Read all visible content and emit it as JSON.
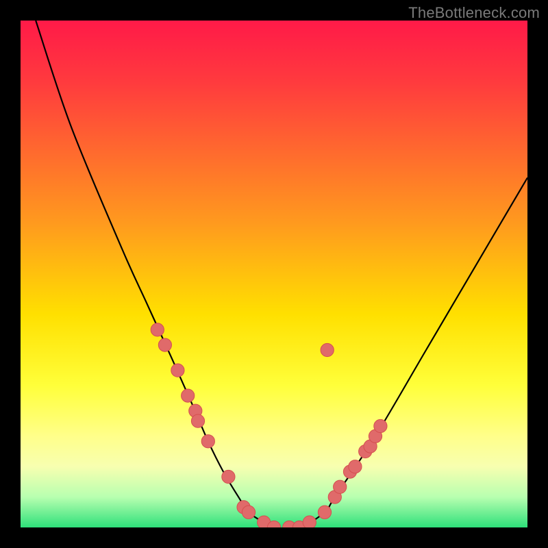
{
  "watermark": "TheBottleneck.com",
  "colors": {
    "background": "#000000",
    "curve": "#000000",
    "dot_fill": "#e06a6a",
    "dot_stroke": "#d44f4f",
    "gradient_top": "#ff1a48",
    "gradient_bottom": "#2ee07a"
  },
  "chart_data": {
    "type": "line",
    "title": "",
    "xlabel": "",
    "ylabel": "",
    "xlim": [
      0,
      100
    ],
    "ylim": [
      0,
      100
    ],
    "grid": false,
    "legend": false,
    "series": [
      {
        "name": "bottleneck-curve",
        "x": [
          3,
          10,
          20,
          25,
          30,
          34,
          37,
          40,
          43,
          45,
          48,
          50,
          55,
          60,
          62,
          70,
          80,
          90,
          100
        ],
        "y": [
          100,
          79,
          55,
          44,
          33,
          24,
          17,
          11,
          6,
          3,
          1,
          0,
          0,
          3,
          6,
          18,
          35,
          52,
          69
        ]
      }
    ],
    "markers": [
      {
        "x": 27,
        "y": 39
      },
      {
        "x": 28.5,
        "y": 36
      },
      {
        "x": 31,
        "y": 31
      },
      {
        "x": 33,
        "y": 26
      },
      {
        "x": 34.5,
        "y": 23
      },
      {
        "x": 35,
        "y": 21
      },
      {
        "x": 37,
        "y": 17
      },
      {
        "x": 41,
        "y": 10
      },
      {
        "x": 44,
        "y": 4
      },
      {
        "x": 45,
        "y": 3
      },
      {
        "x": 48,
        "y": 1
      },
      {
        "x": 50,
        "y": 0
      },
      {
        "x": 53,
        "y": 0
      },
      {
        "x": 55,
        "y": 0
      },
      {
        "x": 57,
        "y": 1
      },
      {
        "x": 60,
        "y": 3
      },
      {
        "x": 62,
        "y": 6
      },
      {
        "x": 63,
        "y": 8
      },
      {
        "x": 65,
        "y": 11
      },
      {
        "x": 66,
        "y": 12
      },
      {
        "x": 68,
        "y": 15
      },
      {
        "x": 69,
        "y": 16
      },
      {
        "x": 70,
        "y": 18
      },
      {
        "x": 71,
        "y": 20
      },
      {
        "x": 60.5,
        "y": 35
      }
    ],
    "marker_radius_pct": 1.3
  }
}
